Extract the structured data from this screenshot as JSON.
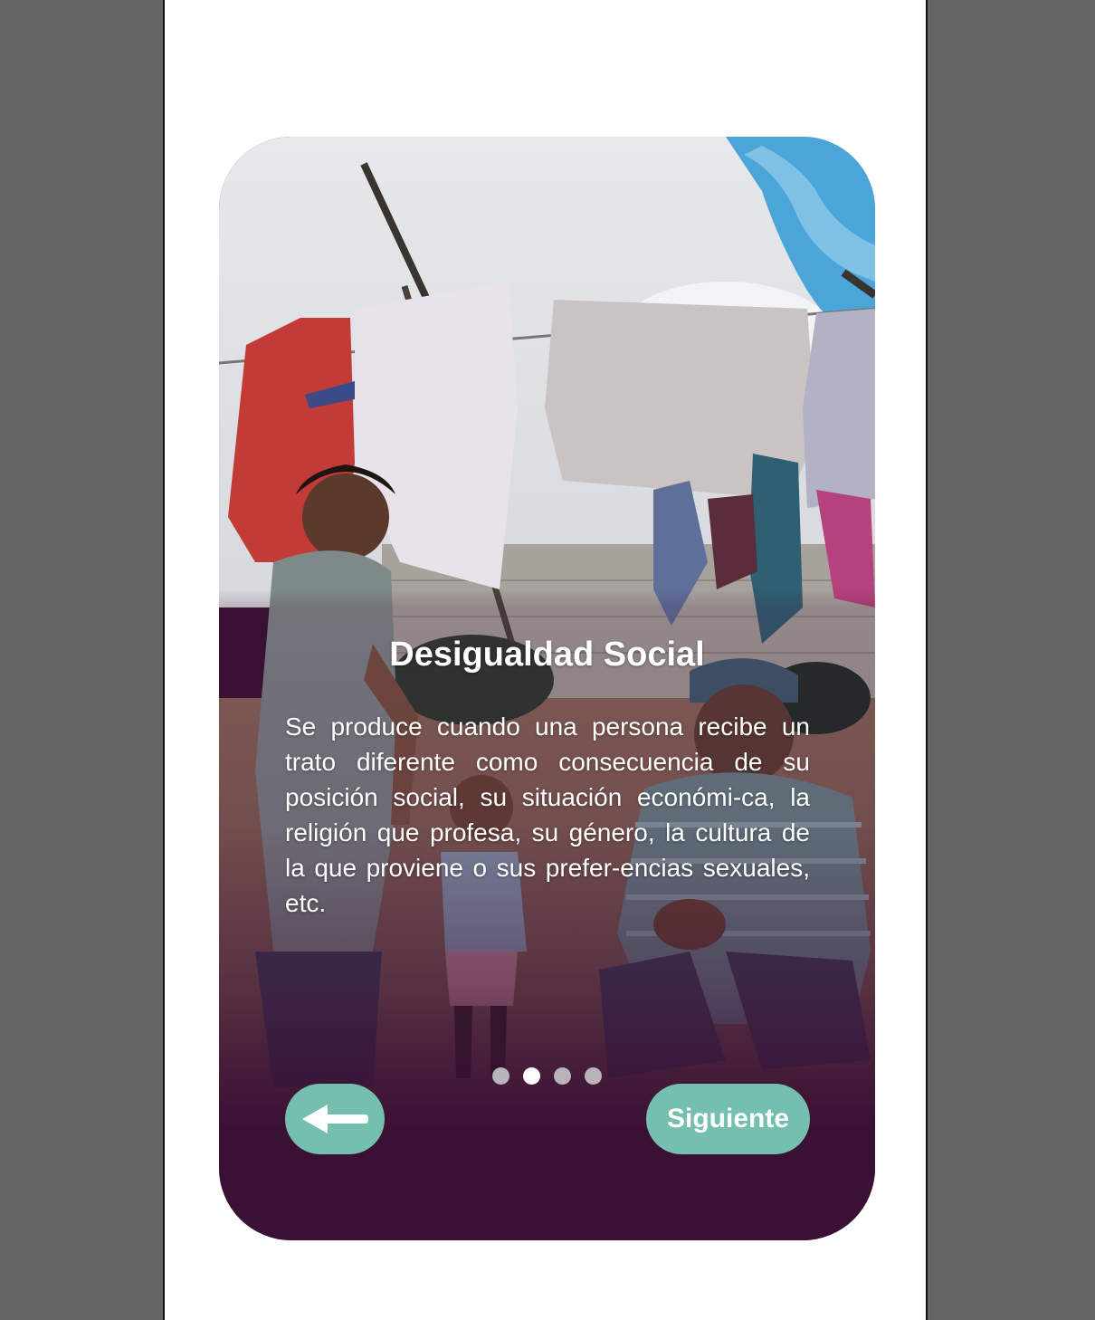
{
  "slide": {
    "title": "Desigualdad Social",
    "body": "Se produce cuando una persona recibe un trato diferente como consecuencia de su posición social, su situación económi-ca, la religión que profesa, su género, la cultura de la que proviene o sus prefer-encias sexuales, etc."
  },
  "pagination": {
    "total": 4,
    "current": 2
  },
  "nav": {
    "back_icon": "arrow-left-icon",
    "next_label": "Siguiente"
  },
  "colors": {
    "page_background": "#646464",
    "screen_background": "#ffffff",
    "card_overlay": "#3a1035",
    "button_accent": "#74bfad",
    "dot_active": "#ffffff",
    "dot_inactive": "#b9b4b9"
  }
}
